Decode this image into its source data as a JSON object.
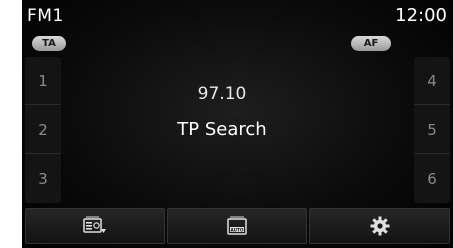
{
  "status_bar": {
    "band": "FM1",
    "clock": "12:00"
  },
  "toggles": {
    "ta_label": "TA",
    "af_label": "AF"
  },
  "presets": {
    "left": [
      "1",
      "2",
      "3"
    ],
    "right": [
      "4",
      "5",
      "6"
    ]
  },
  "tuner": {
    "frequency": "97.10",
    "status": "TP Search"
  },
  "bottom_bar": {
    "buttons": [
      {
        "icon": "radio-list-icon"
      },
      {
        "icon": "radio-auto-icon",
        "label": "AUTO"
      },
      {
        "icon": "gear-icon"
      }
    ]
  },
  "colors": {
    "background": "#000000",
    "text": "#ffffff",
    "preset_text": "#8a8a8a",
    "pill": "#c8c8c8"
  }
}
